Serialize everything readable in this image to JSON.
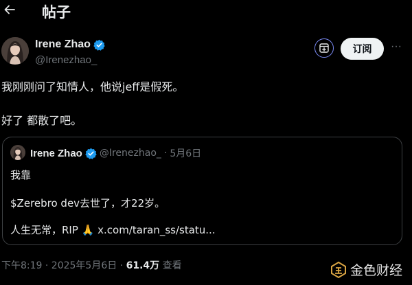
{
  "header": {
    "title": "帖子",
    "back_icon": "arrow-left-icon"
  },
  "author": {
    "name": "Irene Zhao",
    "handle": "@Irenezhao_",
    "verified_color": "#1d9bf0"
  },
  "actions": {
    "subscribe_label": "订阅",
    "save_icon": "bookmark-plus-icon",
    "more_icon": "more-dots-icon",
    "more_glyph": "···",
    "save_ring_color": "#7b8bf5"
  },
  "post": {
    "line1": "我刚刚问了知情人，他说jeff是假死。",
    "line2": "好了 都散了吧。"
  },
  "quote": {
    "name": "Irene Zhao",
    "handle": "@Irenezhao_",
    "separator": "·",
    "date": "5月6日",
    "line1": "我靠",
    "line2": "$Zerebro dev去世了，才22岁。",
    "line3_text": "人生无常，RIP",
    "line3_emoji": "🙏",
    "line3_link": "x.com/taran_ss/statu..."
  },
  "footer": {
    "timestamp": "下午8:19 · 2025年5月6日 · ",
    "views": "61.4万",
    "views_label": " 查看"
  },
  "watermark": {
    "text": "金色财经",
    "logo_color": "#d9a443"
  }
}
